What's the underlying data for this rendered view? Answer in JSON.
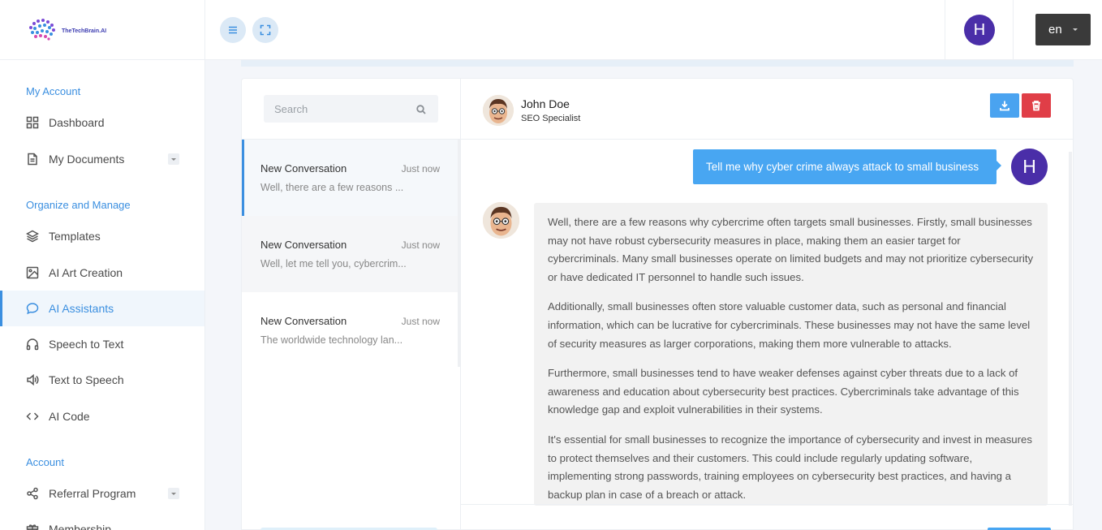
{
  "brand": {
    "logo_text": "TheTechBrain.AI"
  },
  "sidebar": {
    "sections": [
      {
        "label": "My Account"
      },
      {
        "label": "Organize and Manage"
      },
      {
        "label": "Account"
      }
    ],
    "items": [
      {
        "label": "Dashboard",
        "icon": "grid-icon"
      },
      {
        "label": "My Documents",
        "icon": "document-icon"
      },
      {
        "label": "Templates",
        "icon": "layers-icon"
      },
      {
        "label": "AI Art Creation",
        "icon": "image-icon"
      },
      {
        "label": "AI Assistants",
        "icon": "chat-icon",
        "active": true
      },
      {
        "label": "Speech to Text",
        "icon": "headphones-icon"
      },
      {
        "label": "Text to Speech",
        "icon": "speaker-icon"
      },
      {
        "label": "AI Code",
        "icon": "code-icon"
      },
      {
        "label": "Referral Program",
        "icon": "share-icon"
      },
      {
        "label": "Membership",
        "icon": "gift-icon"
      }
    ]
  },
  "header": {
    "user_initial": "H",
    "language": "en"
  },
  "conversations": {
    "search_placeholder": "Search",
    "items": [
      {
        "title": "New Conversation",
        "time": "Just now",
        "preview": "Well, there are a few reasons ..."
      },
      {
        "title": "New Conversation",
        "time": "Just now",
        "preview": "Well, let me tell you, cybercrim..."
      },
      {
        "title": "New Conversation",
        "time": "Just now",
        "preview": "The worldwide technology lan..."
      }
    ]
  },
  "chat": {
    "agent_name": "John Doe",
    "agent_role": "SEO Specialist",
    "user_initial": "H",
    "user_message": "Tell me why cyber crime always attack to small business",
    "bot_paragraphs": [
      "Well, there are a few reasons why cybercrime often targets small businesses. Firstly, small businesses may not have robust cybersecurity measures in place, making them an easier target for cybercriminals. Many small businesses operate on limited budgets and may not prioritize cybersecurity or have dedicated IT personnel to handle such issues.",
      "Additionally, small businesses often store valuable customer data, such as personal and financial information, which can be lucrative for cybercriminals. These businesses may not have the same level of security measures as larger corporations, making them more vulnerable to attacks.",
      "Furthermore, small businesses tend to have weaker defenses against cyber threats due to a lack of awareness and education about cybersecurity best practices. Cybercriminals take advantage of this knowledge gap and exploit vulnerabilities in their systems.",
      "It's essential for small businesses to recognize the importance of cybersecurity and invest in measures to protect themselves and their customers. This could include regularly updating software, implementing strong passwords, training employees on cybersecurity best practices, and having a backup plan in case of a breach or attack."
    ]
  },
  "colors": {
    "accent": "#3b8fe0",
    "user_bubble": "#48a6f2",
    "delete": "#e03e47",
    "avatar": "#4a2ea8"
  }
}
